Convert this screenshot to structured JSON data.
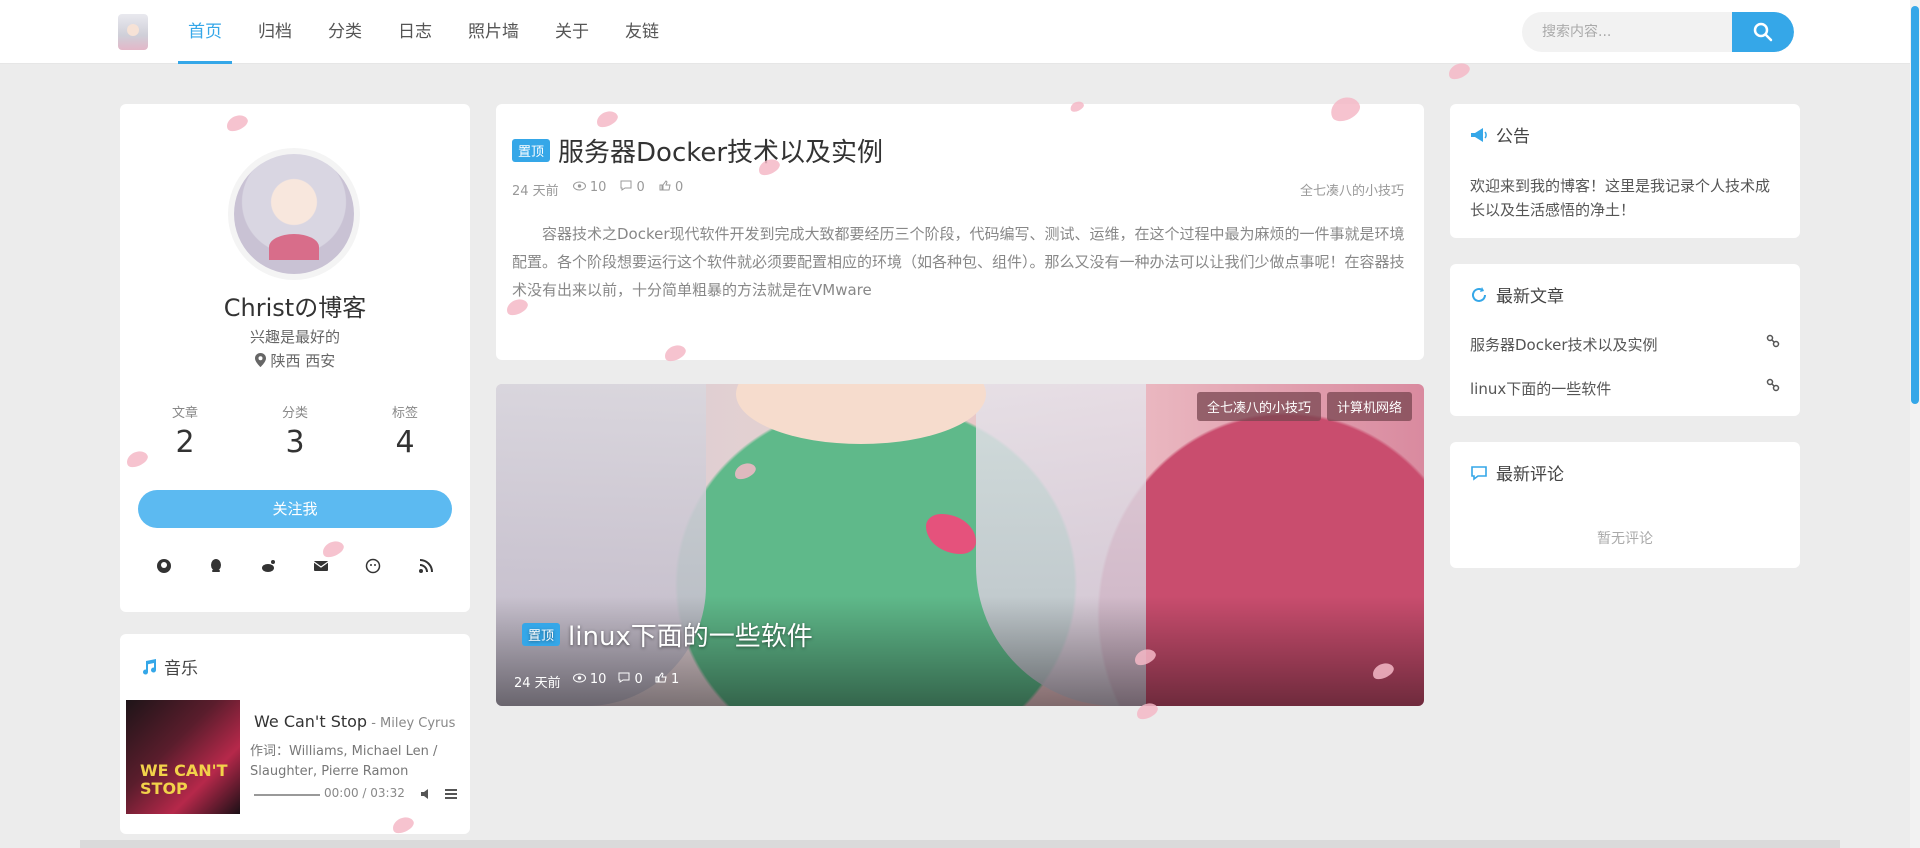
{
  "nav": {
    "items": [
      {
        "label": "首页",
        "active": true
      },
      {
        "label": "归档"
      },
      {
        "label": "分类"
      },
      {
        "label": "日志"
      },
      {
        "label": "照片墙"
      },
      {
        "label": "关于"
      },
      {
        "label": "友链"
      }
    ],
    "search_placeholder": "搜索内容..."
  },
  "profile": {
    "name": "Christの博客",
    "hobby": "兴趣是最好的",
    "location": "陕西 西安",
    "stats": [
      {
        "label": "文章",
        "value": "2"
      },
      {
        "label": "分类",
        "value": "3"
      },
      {
        "label": "标签",
        "value": "4"
      }
    ],
    "follow_label": "关注我",
    "socials": [
      "github-icon",
      "qq-icon",
      "weibo-icon",
      "email-icon",
      "wechat-icon",
      "rss-icon"
    ]
  },
  "music": {
    "title": "音乐",
    "song": "We Can't Stop",
    "artist": " - Miley Cyrus",
    "lyric": "作词：Williams, Michael Len / Slaughter, Pierre Ramon",
    "time": "00:00 / 03:32",
    "cover_text": "WE CAN'T STOP"
  },
  "articles": [
    {
      "badge": "置顶",
      "title": "服务器Docker技术以及实例",
      "meta": [
        "24 天前",
        "10",
        "0",
        "0"
      ],
      "category": "全七凑八的小技巧",
      "excerpt": "容器技术之Docker现代软件开发到完成大致都要经历三个阶段，代码编写、测试、运维，在这个过程中最为麻烦的一件事就是环境配置。各个阶段想要运行这个软件就必须要配置相应的环境（如各种包、组件）。那么又没有一种办法可以让我们少做点事呢！在容器技术没有出来以前，十分简单粗暴的方法就是在VMware"
    },
    {
      "badge": "置顶",
      "title": "linux下面的一些软件",
      "meta": [
        "24 天前",
        "10",
        "0",
        "1"
      ],
      "tags": [
        "全七凑八的小技巧",
        "计算机网络"
      ]
    }
  ],
  "sidebar": {
    "notice_title": "公告",
    "notice_text": "欢迎来到我的博客！这里是我记录个人技术成长以及生活感悟的净土！",
    "latest_title": "最新文章",
    "latest_items": [
      "服务器Docker技术以及实例",
      "linux下面的一些软件"
    ],
    "comments_title": "最新评论",
    "comments_empty": "暂无评论"
  },
  "colors": {
    "accent": "#35a7e8",
    "background": "#ececec",
    "card": "#ffffff",
    "petal": "#f4b8c7"
  }
}
